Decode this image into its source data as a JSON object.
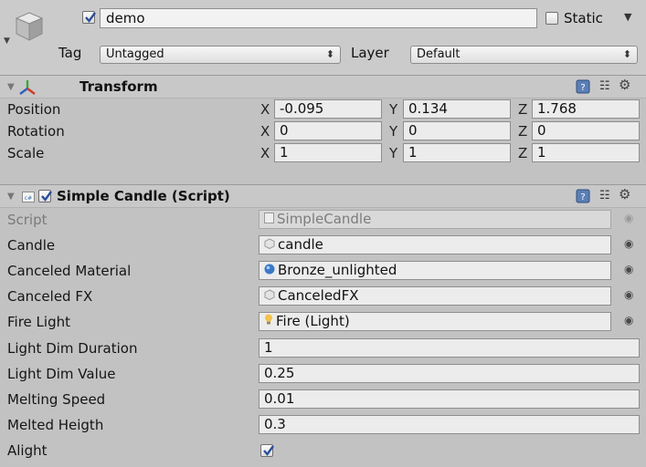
{
  "header": {
    "active": true,
    "name": "demo",
    "static_label": "Static",
    "static_checked": false,
    "tag_label": "Tag",
    "tag_value": "Untagged",
    "layer_label": "Layer",
    "layer_value": "Default"
  },
  "transform": {
    "title": "Transform",
    "rows": [
      {
        "label": "Position",
        "x": "-0.095",
        "y": "0.134",
        "z": "1.768"
      },
      {
        "label": "Rotation",
        "x": "0",
        "y": "0",
        "z": "0"
      },
      {
        "label": "Scale",
        "x": "1",
        "y": "1",
        "z": "1"
      }
    ],
    "axes": {
      "x": "X",
      "y": "Y",
      "z": "Z"
    }
  },
  "script_component": {
    "title": "Simple Candle (Script)",
    "enabled": true,
    "fields": [
      {
        "label": "Script",
        "value": "SimpleCandle",
        "icon": "script-file-icon"
      },
      {
        "label": "Candle",
        "value": "candle",
        "icon": "prefab-icon"
      },
      {
        "label": "Canceled Material",
        "value": "Bronze_unlighted",
        "icon": "material-sphere-icon"
      },
      {
        "label": "Canceled FX",
        "value": "CanceledFX",
        "icon": "prefab-icon"
      },
      {
        "label": "Fire Light",
        "value": "Fire (Light)",
        "icon": "light-bulb-icon"
      },
      {
        "label": "Light Dim Duration",
        "value": "1"
      },
      {
        "label": "Light Dim Value",
        "value": "0.25"
      },
      {
        "label": "Melting Speed",
        "value": "0.01"
      },
      {
        "label": "Melted Heigth",
        "value": "0.3"
      },
      {
        "label": "Alight",
        "checked": true
      }
    ]
  },
  "icons": {
    "picker": "◉",
    "settings": "⚙"
  }
}
